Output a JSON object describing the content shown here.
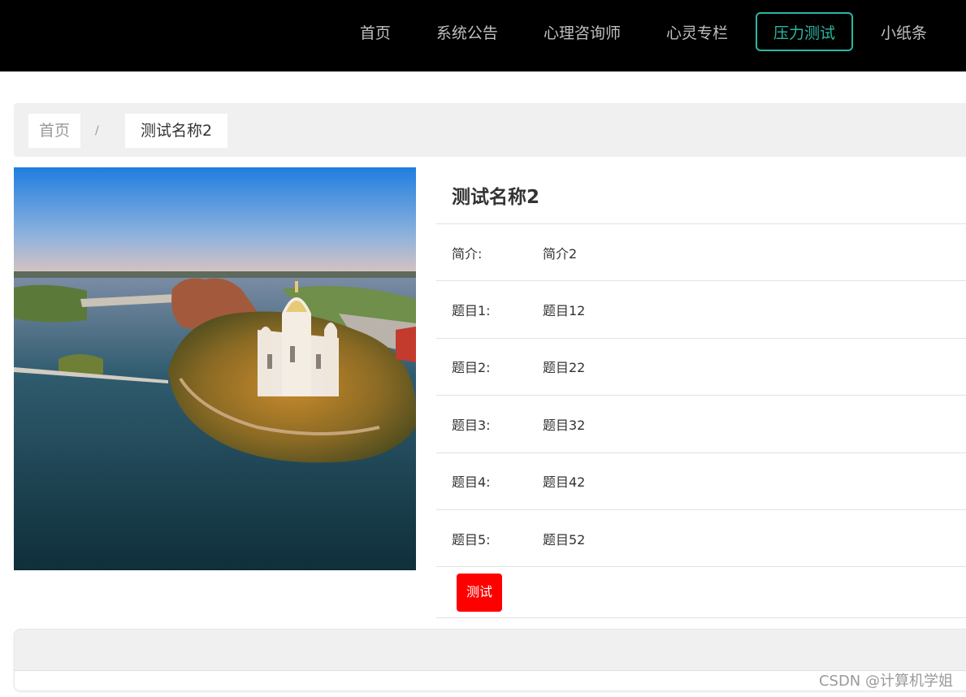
{
  "nav": {
    "items": [
      {
        "label": "首页",
        "active": false
      },
      {
        "label": "系统公告",
        "active": false
      },
      {
        "label": "心理咨询师",
        "active": false
      },
      {
        "label": "心灵专栏",
        "active": false
      },
      {
        "label": "压力测试",
        "active": true
      },
      {
        "label": "小纸条",
        "active": false
      }
    ]
  },
  "breadcrumb": {
    "home": "首页",
    "separator": "/",
    "current": "测试名称2"
  },
  "detail": {
    "title": "测试名称2",
    "rows": [
      {
        "label": "简介:",
        "value": "简介2"
      },
      {
        "label": "题目1:",
        "value": "题目12"
      },
      {
        "label": "题目2:",
        "value": "题目22"
      },
      {
        "label": "题目3:",
        "value": "题目32"
      },
      {
        "label": "题目4:",
        "value": "题目42"
      },
      {
        "label": "题目5:",
        "value": "题目52"
      }
    ],
    "button_label": "测试"
  },
  "colors": {
    "accent": "#2ab6a2",
    "button": "#ff0000",
    "topbar": "#000000"
  },
  "watermark": "CSDN @计算机学姐"
}
